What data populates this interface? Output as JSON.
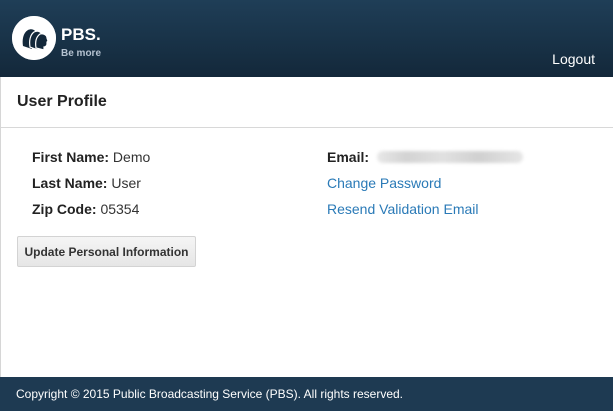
{
  "header": {
    "logo_text": "PBS.",
    "logo_tagline": "Be more",
    "logout_label": "Logout"
  },
  "profile": {
    "title": "User Profile",
    "first_name_label": "First Name:",
    "first_name_value": "Demo",
    "last_name_label": "Last Name:",
    "last_name_value": "User",
    "zip_label": "Zip Code:",
    "zip_value": "05354",
    "email_label": "Email:",
    "email_value_obscured": true,
    "change_password_label": "Change Password",
    "resend_validation_label": "Resend Validation Email",
    "update_button_label": "Update Personal Information"
  },
  "footer": {
    "copyright": "Copyright © 2015 Public Broadcasting Service (PBS). All rights reserved."
  },
  "colors": {
    "header_bg": "#1f3e57",
    "footer_bg": "#1e3a52",
    "link": "#2a7ab7"
  },
  "icons": {
    "logo": "pbs-heads-logo-icon"
  }
}
